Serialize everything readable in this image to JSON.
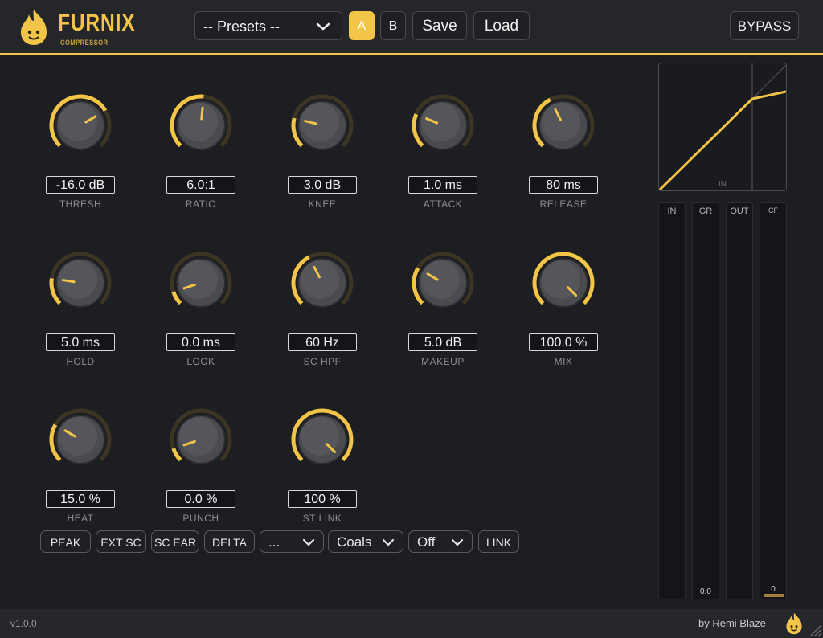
{
  "header": {
    "title": "FURNIX",
    "subtitle": "COMPRESSOR",
    "presets_label": "-- Presets --",
    "btn_a": "A",
    "btn_b": "B",
    "save": "Save",
    "load": "Load",
    "bypass": "BYPASS",
    "accent_color": "#f2c447"
  },
  "knobs": [
    {
      "label": "THRESH",
      "value": "-16.0 dB",
      "level": 0.72,
      "arc": "fill"
    },
    {
      "label": "RATIO",
      "value": "6.0:1",
      "level": 0.52,
      "arc": "fill"
    },
    {
      "label": "KNEE",
      "value": "3.0 dB",
      "level": 0.22,
      "arc": "fill"
    },
    {
      "label": "ATTACK",
      "value": "1.0 ms",
      "level": 0.25,
      "arc": "fill"
    },
    {
      "label": "RELEASE",
      "value": "80 ms",
      "level": 0.4,
      "arc": "fill"
    },
    {
      "label": "HOLD",
      "value": "5.0 ms",
      "level": 0.2,
      "arc": "fill"
    },
    {
      "label": "LOOK",
      "value": "0.0 ms",
      "level": 0.1,
      "arc": "fill"
    },
    {
      "label": "SC HPF",
      "value": "60 Hz",
      "level": 0.4,
      "arc": "fill"
    },
    {
      "label": "MAKEUP",
      "value": "5.0 dB",
      "level": 0.28,
      "arc": "fill"
    },
    {
      "label": "MIX",
      "value": "100.0 %",
      "level": 1.0,
      "arc": "fill"
    },
    {
      "label": "HEAT",
      "value": "15.0 %",
      "level": 0.28,
      "arc": "fill"
    },
    {
      "label": "PUNCH",
      "value": "0.0 %",
      "level": 0.1,
      "arc": "fill"
    },
    {
      "label": "ST LINK",
      "value": "100 %",
      "level": 1.0,
      "arc": "fill"
    }
  ],
  "buttons": {
    "peak": "PEAK",
    "ext_sc": "EXT SC",
    "sc_ear": "SC EAR",
    "delta": "DELTA",
    "select_1": "...",
    "select_2": "Coals",
    "select_3": "Off",
    "link": "LINK"
  },
  "graph": {
    "axis_label": "IN"
  },
  "meters": [
    {
      "label": "IN",
      "value": ""
    },
    {
      "label": "GR",
      "value": "0.0"
    },
    {
      "label": "OUT",
      "value": ""
    },
    {
      "label": "CF",
      "value": "0"
    }
  ],
  "footer": {
    "version": "v1.0.0",
    "author": "by Remi Blaze"
  },
  "icons": [
    "flame-mascot-icon",
    "chevron-down-icon",
    "resize-grip-icon"
  ]
}
